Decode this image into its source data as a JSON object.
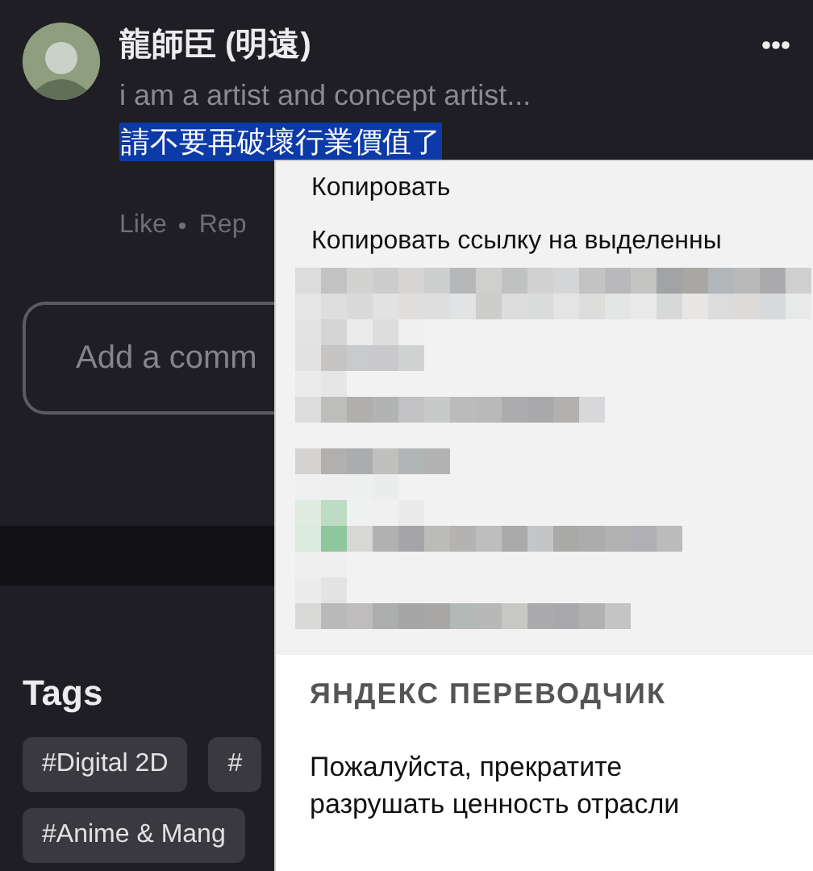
{
  "comment": {
    "author": "龍師臣 (明遠)",
    "subtitle": "i am a artist and concept artist...",
    "text": "請不要再破壞行業價值了",
    "text_selected": true,
    "actions": [
      "Like",
      "Rep"
    ]
  },
  "comment_field": {
    "placeholder": "Add a comm"
  },
  "tags": {
    "title": "Tags",
    "items": [
      {
        "label": "#Digital 2D"
      },
      {
        "label": "#"
      },
      {
        "label": "#Anime & Mang"
      }
    ]
  },
  "context_menu": {
    "items": [
      "Копировать",
      "Копировать ссылку на выделенны"
    ],
    "translator": {
      "title": "ЯНДЕКС ПЕРЕВОДЧИК",
      "translation": "Пожалуйста, прекратите разрушать ценность отрасли"
    }
  }
}
